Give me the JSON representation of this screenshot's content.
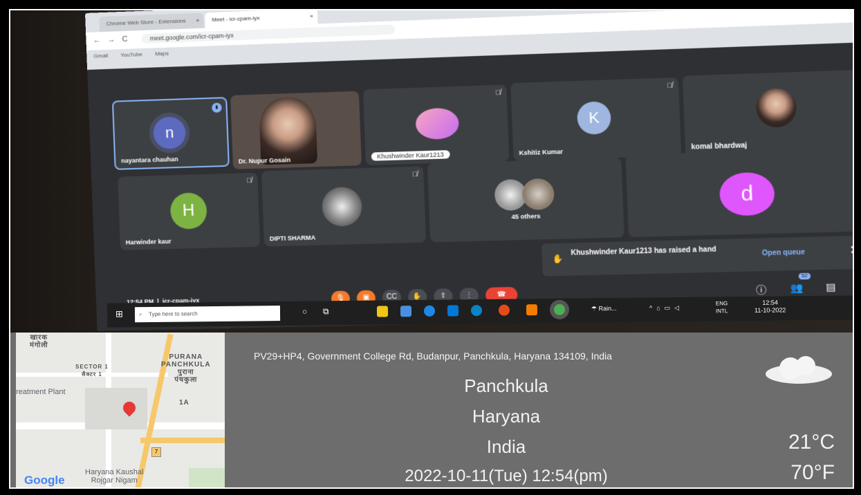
{
  "browser": {
    "tabs": [
      "Chrome Web Store - Extensions",
      "Meet - icr-cpam-iyx"
    ],
    "url": "meet.google.com/icr-cpam-iyx",
    "bookmarks": [
      "Gmail",
      "YouTube",
      "Maps"
    ]
  },
  "meet": {
    "participants": [
      {
        "name": "nayantara chauhan",
        "initial": "n",
        "color": "#5c6bc0"
      },
      {
        "name": "Dr. Nupur Gosain"
      },
      {
        "name": "Khushwinder Kaur1213"
      },
      {
        "name": "Kshitiz Kumar",
        "initial": "K",
        "color": "#9fb6e0"
      },
      {
        "name": "komal bhardwaj"
      },
      {
        "name": "Harwinder kaur",
        "initial": "H",
        "color": "#7cb342"
      },
      {
        "name": "DIPTI SHARMA"
      },
      {
        "name": "45 others"
      },
      {
        "name": "",
        "initial": "d",
        "color": "#e056fd"
      }
    ],
    "raise_hand_toast": "Khushwinder Kaur1213 has raised a hand",
    "open_queue": "Open queue",
    "time": "12:54 PM",
    "meeting_code": "icr-cpam-iyx",
    "people_count": "52"
  },
  "taskbar": {
    "search_placeholder": "Type here to search",
    "weather": "Rain...",
    "lang_top": "ENG",
    "lang_bottom": "INTL",
    "clock_time": "12:54",
    "clock_date": "11-10-2022"
  },
  "map": {
    "labels": {
      "kharak": "खारक\nमंगोली",
      "sector1": "SECTOR 1\nसैक्टर 1",
      "purana": "PURANA\nPANCHKULA\nपुराना\nपंचकुला",
      "plant": "reatment Plant",
      "one_a": "1A",
      "kaushal": "Haryana Kaushal\nRojgar Nigam",
      "route": "7"
    },
    "google": "Google"
  },
  "location": {
    "address": "PV29+HP4, Government College Rd, Budanpur, Panchkula, Haryana 134109, India",
    "city": "Panchkula",
    "state": "Haryana",
    "country": "India",
    "datetime": "2022-10-11(Tue)  12:54(pm)",
    "temp_c": "21°C",
    "temp_f": "70°F"
  }
}
